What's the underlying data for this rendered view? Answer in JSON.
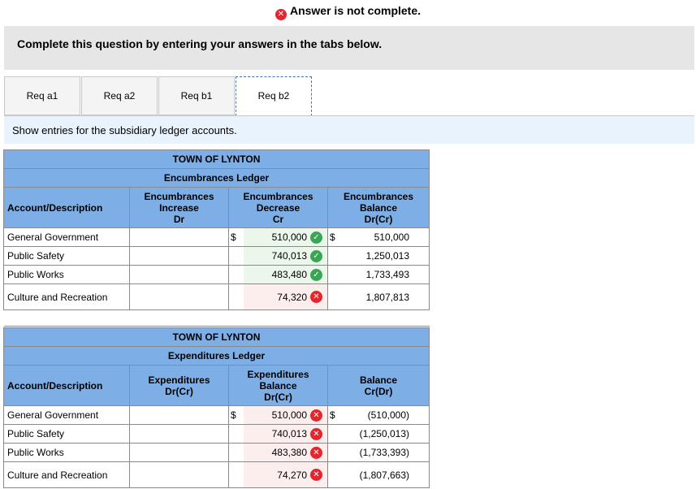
{
  "status": {
    "text": "Answer is not complete."
  },
  "instruction": "Complete this question by entering your answers in the tabs below.",
  "tabs": [
    {
      "label": "Req a1"
    },
    {
      "label": "Req a2"
    },
    {
      "label": "Req b1"
    },
    {
      "label": "Req b2"
    }
  ],
  "subtitle": "Show entries for the subsidiary ledger accounts.",
  "encumbrances": {
    "town": "TOWN OF LYNTON",
    "title": "Encumbrances Ledger",
    "col_account": "Account/Description",
    "col_increase": [
      "Encumbrances",
      "Increase",
      "Dr"
    ],
    "col_decrease": [
      "Encumbrances",
      "Decrease",
      "Cr"
    ],
    "col_balance": [
      "Encumbrances",
      "Balance",
      "Dr(Cr)"
    ],
    "dollar": "$",
    "rows": [
      {
        "account": "General Government",
        "decrease": "510,000",
        "balance": "510,000",
        "status": "correct"
      },
      {
        "account": "Public Safety",
        "decrease": "740,013",
        "balance": "1,250,013",
        "status": "correct"
      },
      {
        "account": "Public Works",
        "decrease": "483,480",
        "balance": "1,733,493",
        "status": "correct"
      },
      {
        "account": "Culture and Recreation",
        "decrease": "74,320",
        "balance": "1,807,813",
        "status": "incorrect"
      }
    ]
  },
  "expenditures": {
    "town": "TOWN OF LYNTON",
    "title": "Expenditures Ledger",
    "col_account": "Account/Description",
    "col_expenditures": [
      "Expenditures",
      "Dr(Cr)"
    ],
    "col_exp_balance": [
      "Expenditures",
      "Balance",
      "Dr(Cr)"
    ],
    "col_balance": [
      "Balance",
      "Cr(Dr)"
    ],
    "dollar": "$",
    "rows": [
      {
        "account": "General Government",
        "exp_balance": "510,000",
        "balance": "(510,000)",
        "status": "incorrect"
      },
      {
        "account": "Public Safety",
        "exp_balance": "740,013",
        "balance": "(1,250,013)",
        "status": "incorrect"
      },
      {
        "account": "Public Works",
        "exp_balance": "483,380",
        "balance": "(1,733,393)",
        "status": "incorrect"
      },
      {
        "account": "Culture and Recreation",
        "exp_balance": "74,270",
        "balance": "(1,807,663)",
        "status": "incorrect"
      }
    ]
  },
  "colors": {
    "header": "#7eaee6",
    "correct": "#3aa655",
    "incorrect": "#e3262e"
  },
  "icons": {
    "correct": "check-circle-icon",
    "incorrect": "x-circle-icon"
  }
}
